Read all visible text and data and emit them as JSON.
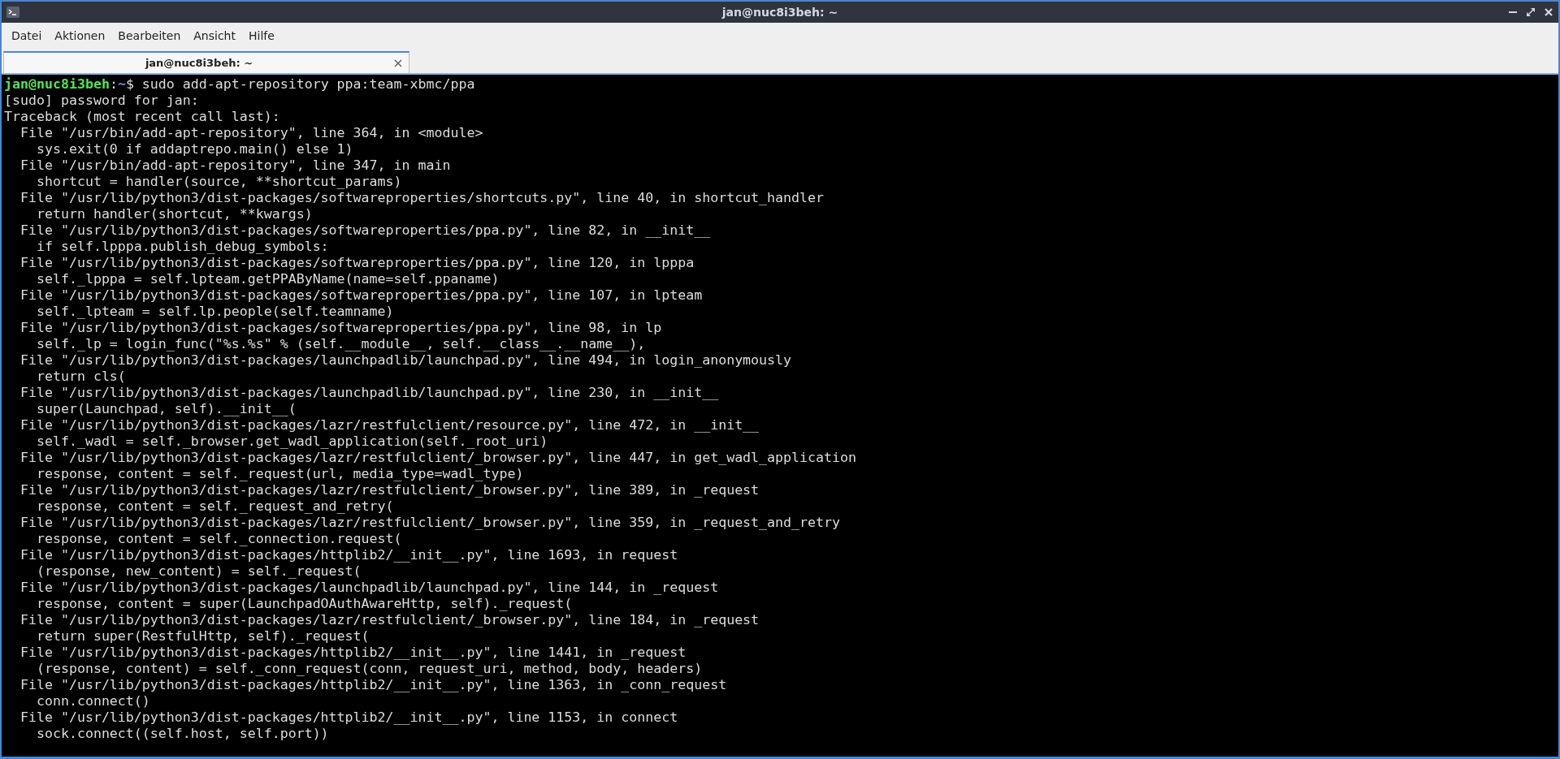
{
  "window": {
    "title": "jan@nuc8i3beh: ~"
  },
  "menu": [
    "Datei",
    "Aktionen",
    "Bearbeiten",
    "Ansicht",
    "Hilfe"
  ],
  "tabs": [
    {
      "label": "jan@nuc8i3beh: ~",
      "selected": true
    }
  ],
  "terminal": {
    "prompt": {
      "user_host": "jan@nuc8i3beh",
      "separator": ":",
      "path": "~",
      "command": "$ sudo add-apt-repository ppa:team-xbmc/ppa"
    },
    "lines": [
      "[sudo] password for jan:",
      "Traceback (most recent call last):",
      "  File \"/usr/bin/add-apt-repository\", line 364, in <module>",
      "    sys.exit(0 if addaptrepo.main() else 1)",
      "  File \"/usr/bin/add-apt-repository\", line 347, in main",
      "    shortcut = handler(source, **shortcut_params)",
      "  File \"/usr/lib/python3/dist-packages/softwareproperties/shortcuts.py\", line 40, in shortcut_handler",
      "    return handler(shortcut, **kwargs)",
      "  File \"/usr/lib/python3/dist-packages/softwareproperties/ppa.py\", line 82, in __init__",
      "    if self.lpppa.publish_debug_symbols:",
      "  File \"/usr/lib/python3/dist-packages/softwareproperties/ppa.py\", line 120, in lpppa",
      "    self._lpppa = self.lpteam.getPPAByName(name=self.ppaname)",
      "  File \"/usr/lib/python3/dist-packages/softwareproperties/ppa.py\", line 107, in lpteam",
      "    self._lpteam = self.lp.people(self.teamname)",
      "  File \"/usr/lib/python3/dist-packages/softwareproperties/ppa.py\", line 98, in lp",
      "    self._lp = login_func(\"%s.%s\" % (self.__module__, self.__class__.__name__),",
      "  File \"/usr/lib/python3/dist-packages/launchpadlib/launchpad.py\", line 494, in login_anonymously",
      "    return cls(",
      "  File \"/usr/lib/python3/dist-packages/launchpadlib/launchpad.py\", line 230, in __init__",
      "    super(Launchpad, self).__init__(",
      "  File \"/usr/lib/python3/dist-packages/lazr/restfulclient/resource.py\", line 472, in __init__",
      "    self._wadl = self._browser.get_wadl_application(self._root_uri)",
      "  File \"/usr/lib/python3/dist-packages/lazr/restfulclient/_browser.py\", line 447, in get_wadl_application",
      "    response, content = self._request(url, media_type=wadl_type)",
      "  File \"/usr/lib/python3/dist-packages/lazr/restfulclient/_browser.py\", line 389, in _request",
      "    response, content = self._request_and_retry(",
      "  File \"/usr/lib/python3/dist-packages/lazr/restfulclient/_browser.py\", line 359, in _request_and_retry",
      "    response, content = self._connection.request(",
      "  File \"/usr/lib/python3/dist-packages/httplib2/__init__.py\", line 1693, in request",
      "    (response, new_content) = self._request(",
      "  File \"/usr/lib/python3/dist-packages/launchpadlib/launchpad.py\", line 144, in _request",
      "    response, content = super(LaunchpadOAuthAwareHttp, self)._request(",
      "  File \"/usr/lib/python3/dist-packages/lazr/restfulclient/_browser.py\", line 184, in _request",
      "    return super(RestfulHttp, self)._request(",
      "  File \"/usr/lib/python3/dist-packages/httplib2/__init__.py\", line 1441, in _request",
      "    (response, content) = self._conn_request(conn, request_uri, method, body, headers)",
      "  File \"/usr/lib/python3/dist-packages/httplib2/__init__.py\", line 1363, in _conn_request",
      "    conn.connect()",
      "  File \"/usr/lib/python3/dist-packages/httplib2/__init__.py\", line 1153, in connect",
      "    sock.connect((self.host, self.port))"
    ]
  }
}
